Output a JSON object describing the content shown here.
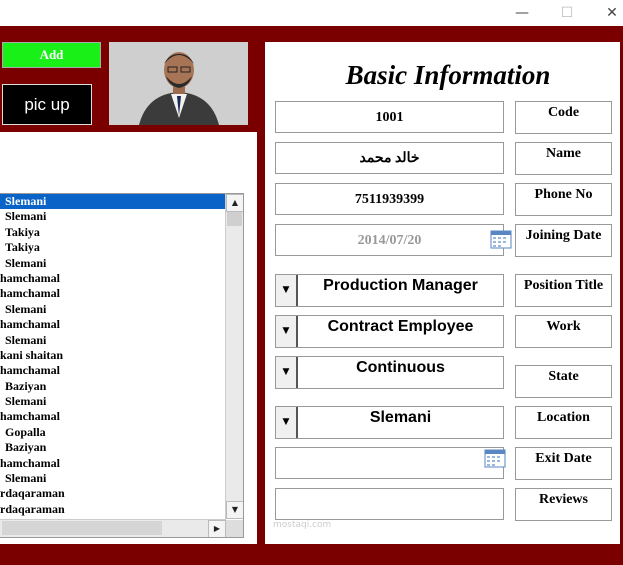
{
  "window": {
    "controls": {
      "minimize": "—",
      "maximize": "☐",
      "close": "✕"
    }
  },
  "left": {
    "add_label": "Add",
    "picup_label": "pic up",
    "list_items": [
      "Slemani",
      "Slemani",
      "Takiya",
      "Takiya",
      "Slemani",
      "hamchamal",
      "hamchamal",
      "Slemani",
      "hamchamal",
      "Slemani",
      "kani shaitan",
      "hamchamal",
      "Baziyan",
      "Slemani",
      "hamchamal",
      "Gopalla",
      "Baziyan",
      "hamchamal",
      "Slemani",
      "rdaqaraman",
      "rdaqaraman"
    ],
    "selected_index": 0
  },
  "form": {
    "title": "Basic Information",
    "code_value": "1001",
    "name_value": "خالد محمد",
    "phone_value": "7511939399",
    "joining_date_value": "2014/07/20",
    "position_value": "Production Manager",
    "work_value": "Contract Employee",
    "state_value": "Continuous",
    "location_value": "Slemani",
    "exit_date_value": "",
    "reviews_value": "",
    "labels": {
      "code": "Code",
      "name": "Name",
      "phone": "Phone No",
      "joining_date": "Joining Date",
      "position": "Position Title",
      "work": "Work",
      "state": "State",
      "location": "Location",
      "exit_date": "Exit Date",
      "reviews": "Reviews"
    }
  },
  "watermark": "mostaqi.com",
  "colors": {
    "frame": "#7a0000",
    "add_button": "#18f018",
    "selection": "#0a64c8"
  }
}
